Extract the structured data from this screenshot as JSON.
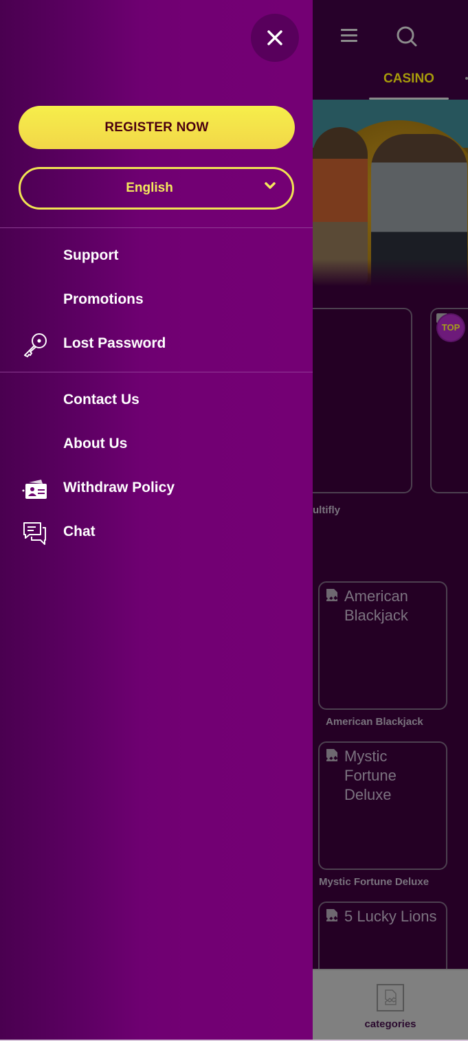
{
  "background_page": {
    "header": {
      "menu_icon": "hamburger-icon",
      "search_icon": "search-icon",
      "active_tab": "CASINO"
    },
    "games": [
      {
        "title": "",
        "caption": "ultifly"
      },
      {
        "title": "",
        "caption": "",
        "badge": "TOP"
      },
      {
        "title": "American Blackjack",
        "caption": "American Blackjack"
      },
      {
        "title": "Mystic Fortune Deluxe",
        "caption": "Mystic Fortune Deluxe"
      },
      {
        "title": "5 Lucky Lions",
        "caption": ""
      }
    ],
    "bottom_nav": {
      "label": "categories",
      "icon": "broken-image-icon"
    }
  },
  "drawer": {
    "close_icon": "close-icon",
    "register_label": "REGISTER NOW",
    "language": {
      "selected": "English",
      "icon": "chevron-down-icon"
    },
    "menu_group_1": [
      {
        "label": "Support",
        "icon": ""
      },
      {
        "label": "Promotions",
        "icon": ""
      },
      {
        "label": "Lost Password",
        "icon": "key-icon"
      }
    ],
    "menu_group_2": [
      {
        "label": "Contact Us",
        "icon": ""
      },
      {
        "label": "About Us",
        "icon": ""
      },
      {
        "label": "Withdraw Policy",
        "icon": "id-card-icon"
      },
      {
        "label": "Chat",
        "icon": "chat-icon"
      }
    ]
  },
  "colors": {
    "drawer_purple": "#740074",
    "accent_yellow": "#f4e85c",
    "register_text": "#4a0010",
    "page_bg": "#250025"
  }
}
